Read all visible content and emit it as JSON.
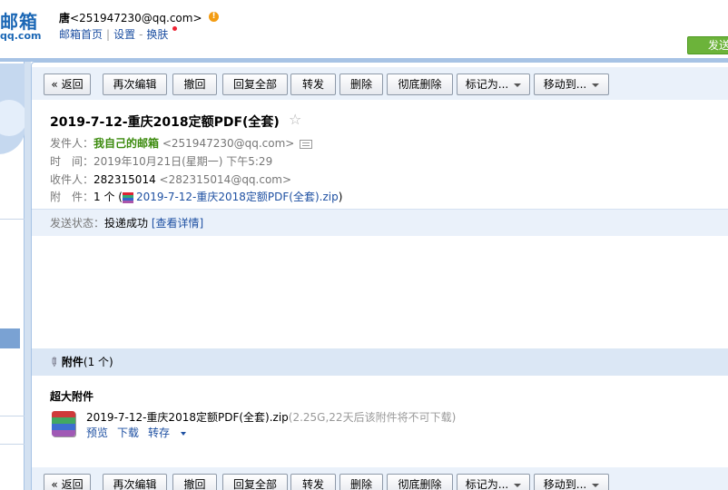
{
  "header": {
    "logo_main": "邮箱",
    "logo_sub": "qq.com",
    "user_name": "唐",
    "user_email": "<251947230@qq.com>",
    "vip_glyph": "!",
    "links": [
      "邮箱首页",
      "设置",
      "换肤"
    ],
    "send_label": "发送"
  },
  "toolbar": {
    "back": "« 返回",
    "re_edit": "再次编辑",
    "recall": "撤回",
    "reply_all": "回复全部",
    "forward": "转发",
    "delete": "删除",
    "delete_perm": "彻底删除",
    "mark_as": "标记为...",
    "move_to": "移动到..."
  },
  "mail": {
    "subject": "2019-7-12-重庆2018定额PDF(全套)",
    "star": "☆",
    "from_label": "发件人：",
    "from_name": "我自己的邮箱",
    "from_email": "<251947230@qq.com>",
    "time_label": "时　间：",
    "time_value": "2019年10月21日(星期一) 下午5:29",
    "to_label": "收件人：",
    "to_name": "282315014",
    "to_email": "<282315014@qq.com>",
    "att_label": "附　件：",
    "att_count_prefix": "1 个 (",
    "att_filename": "2019-7-12-重庆2018定额PDF(全套).zip",
    "att_count_suffix": ")",
    "status_label": "发送状态：",
    "status_value": "投递成功",
    "status_link": "[查看详情]"
  },
  "attachments": {
    "bar_title": "附件",
    "bar_count": "(1 个)",
    "section_label": "超大附件",
    "file_name": "2019-7-12-重庆2018定额PDF(全套).zip",
    "file_info": "(2.25G,22天后该附件将不可下载)",
    "actions": {
      "preview": "预览",
      "download": "下载",
      "save": "转存"
    }
  }
}
